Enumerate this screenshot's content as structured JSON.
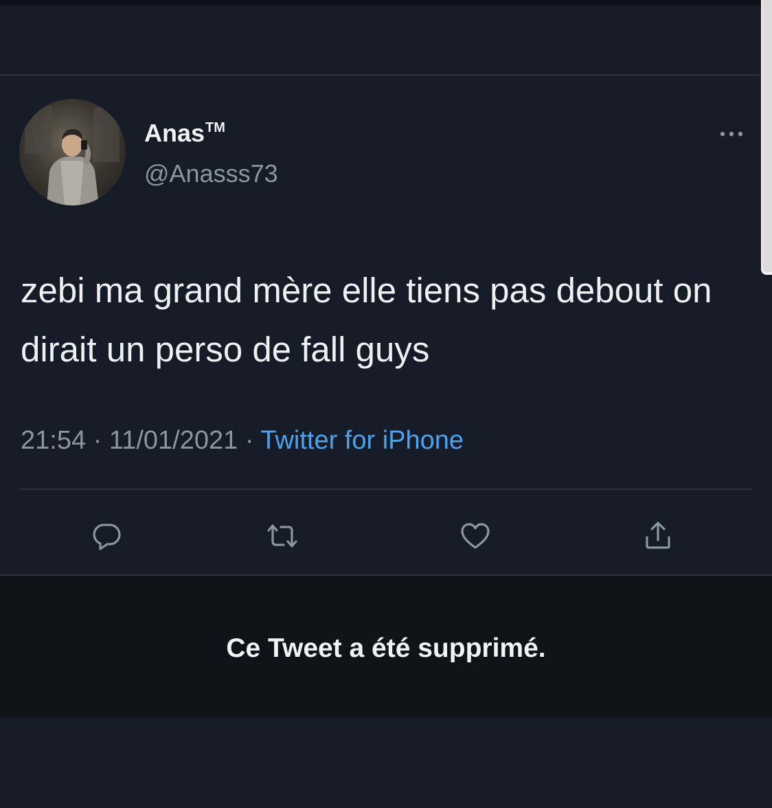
{
  "tweet": {
    "display_name": "Anas",
    "display_name_mark": "TM",
    "handle": "@Anasss73",
    "text": "zebi ma grand mère elle tiens pas debout on dirait un perso de fall guys",
    "time": "21:54",
    "separator": "·",
    "date": "11/01/2021",
    "source": "Twitter for iPhone"
  },
  "deleted_notice": "Ce Tweet a été supprimé.",
  "icons": {
    "more": "more-horizontal-icon",
    "reply": "reply-icon",
    "retweet": "retweet-icon",
    "like": "heart-icon",
    "share": "share-icon"
  },
  "colors": {
    "background": "#151b27",
    "deleted_card": "#0f1218",
    "text_primary": "#eef0f2",
    "text_secondary": "#8b96a3",
    "link": "#4aa3ec",
    "divider": "#2a313d"
  }
}
